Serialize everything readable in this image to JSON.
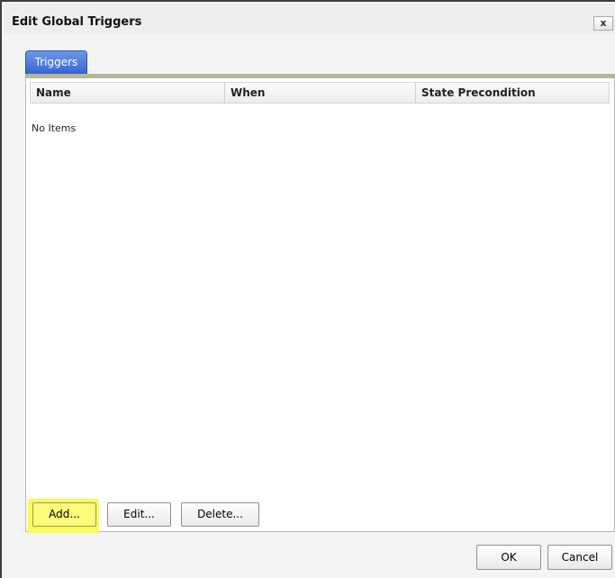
{
  "dialog": {
    "title": "Edit Global Triggers",
    "close_label": "x"
  },
  "tabs": [
    {
      "label": "Triggers",
      "active": true
    }
  ],
  "grid": {
    "columns": [
      "Name",
      "When",
      "State Precondition"
    ],
    "rows": [],
    "empty_text": "No Items"
  },
  "actions": {
    "add_label": "Add...",
    "edit_label": "Edit...",
    "delete_label": "Delete..."
  },
  "footer": {
    "ok_label": "OK",
    "cancel_label": "Cancel"
  },
  "colors": {
    "tab_active": "#3565d3",
    "highlight": "#fbfb5a"
  }
}
